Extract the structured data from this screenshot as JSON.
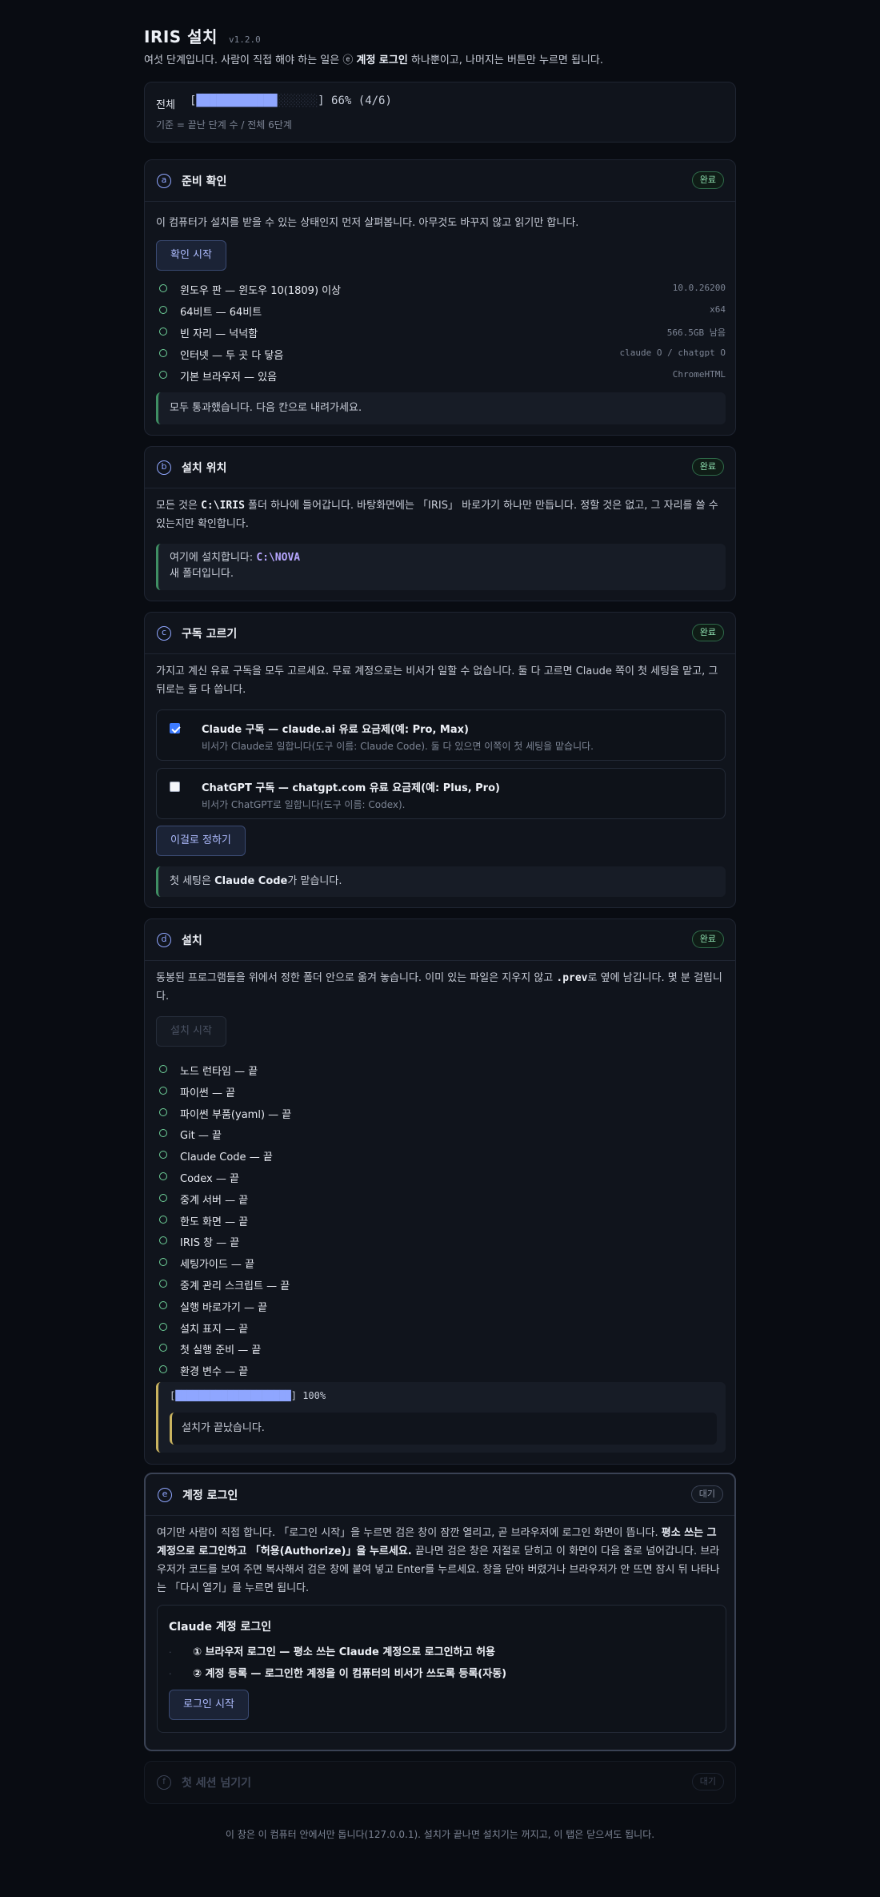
{
  "header": {
    "title": "IRIS 설치",
    "version": "v1.2.0",
    "intro_pre": "여섯 단계입니다. 사람이 직접 해야 하는 일은 ⓔ ",
    "intro_bold": "계정 로그인",
    "intro_post": " 하나뿐이고, 나머지는 버튼만 누르면 됩니다."
  },
  "overall": {
    "label": "전체",
    "bar_open": "[",
    "bar_filled": "████████████",
    "bar_empty": "░░░░░░",
    "bar_close": "]",
    "percent_text": "66% (4/6)",
    "progress": 0.66,
    "note": "기준 = 끝난 단계 수 / 전체 6단계"
  },
  "step_a": {
    "letter": "a",
    "title": "준비 확인",
    "badge": "완료",
    "desc": "이 컴퓨터가 설치를 받을 수 있는 상태인지 먼저 살펴봅니다. 아무것도 바꾸지 않고 읽기만 합니다.",
    "button": "확인 시작",
    "checks": [
      {
        "label": "윈도우 판 — 윈도우 10(1809) 이상",
        "value": "10.0.26200"
      },
      {
        "label": "64비트 — 64비트",
        "value": "x64"
      },
      {
        "label": "빈 자리 — 넉넉함",
        "value": "566.5GB 남음"
      },
      {
        "label": "인터넷 — 두 곳 다 닿음",
        "value": "claude O / chatgpt O"
      },
      {
        "label": "기본 브라우저 — 있음",
        "value": "ChromeHTML"
      }
    ],
    "note": "모두 통과했습니다. 다음 칸으로 내려가세요."
  },
  "step_b": {
    "letter": "b",
    "title": "설치 위치",
    "badge": "완료",
    "desc_pre": "모든 것은 ",
    "desc_code": "C:\\IRIS",
    "desc_post": " 폴더 하나에 들어갑니다. 바탕화면에는 「IRIS」 바로가기 하나만 만듭니다. 정할 것은 없고, 그 자리를 쓸 수 있는지만 확인합니다.",
    "note_pre": "여기에 설치합니다: ",
    "note_code": "C:\\NOVA",
    "note_line2": "새 폴더입니다."
  },
  "step_c": {
    "letter": "c",
    "title": "구독 고르기",
    "badge": "완료",
    "desc": "가지고 계신 유료 구독을 모두 고르세요. 무료 계정으로는 비서가 일할 수 없습니다. 둘 다 고르면 Claude 쪽이 첫 세팅을 맡고, 그 뒤로는 둘 다 씁니다.",
    "options": [
      {
        "title": "Claude 구독 — claude.ai 유료 요금제(예: Pro, Max)",
        "sub": "비서가 Claude로 일합니다(도구 이름: Claude Code). 둘 다 있으면 이쪽이 첫 세팅을 맡습니다.",
        "checked": true
      },
      {
        "title": "ChatGPT 구독 — chatgpt.com 유료 요금제(예: Plus, Pro)",
        "sub": "비서가 ChatGPT로 일합니다(도구 이름: Codex).",
        "checked": false
      }
    ],
    "button": "이걸로 정하기",
    "note_pre": "첫 세팅은 ",
    "note_bold": "Claude Code",
    "note_post": "가 맡습니다."
  },
  "step_d": {
    "letter": "d",
    "title": "설치",
    "badge": "완료",
    "desc_pre": "동봉된 프로그램들을 위에서 정한 폴더 안으로 옮겨 놓습니다. 이미 있는 파일은 지우지 않고 ",
    "desc_code": ".prev",
    "desc_post": "로 옆에 남깁니다. 몇 분 걸립니다.",
    "button": "설치 시작",
    "items": [
      "노드 런타임 — 끝",
      "파이썬 — 끝",
      "파이썬 부품(yaml) — 끝",
      "Git — 끝",
      "Claude Code — 끝",
      "Codex — 끝",
      "중계 서버 — 끝",
      "한도 화면 — 끝",
      "IRIS 창 — 끝",
      "세팅가이드 — 끝",
      "중계 관리 스크립트 — 끝",
      "실행 바로가기 — 끝",
      "설치 표지 — 끝",
      "첫 실행 준비 — 끝",
      "환경 변수 — 끝"
    ],
    "bar_open": "[",
    "bar_filled": "████████████████████",
    "bar_close": "]",
    "percent_text": "100%",
    "progress": 1.0,
    "done_note": "설치가 끝났습니다."
  },
  "step_e": {
    "letter": "e",
    "title": "계정 로그인",
    "badge": "대기",
    "desc_1": "여기만 사람이 직접 합니다. 「로그인 시작」을 누르면 검은 창이 잠깐 열리고, 곧 브라우저에 로그인 화면이 뜹니다. ",
    "desc_bold_1": "평소 쓰는 그 계정으로 로그인하고 「허용(Authorize)」을 누르세요.",
    "desc_2": " 끝나면 검은 창은 저절로 닫히고 이 화면이 다음 줄로 넘어갑니다. 브라우저가 코드를 보여 주면 복사해서 검은 창에 붙여 넣고 Enter를 누르세요. 창을 닫아 버렸거나 브라우저가 안 뜨면 잠시 뒤 나타나는 「다시 열기」를 누르면 됩니다.",
    "login_title": "Claude 계정 로그인",
    "login_steps": [
      {
        "bullet": "·",
        "text": "① 브라우저 로그인 — 평소 쓰는 Claude 계정으로 로그인하고 허용"
      },
      {
        "bullet": "·",
        "text": "② 계정 등록 — 로그인한 계정을 이 컴퓨터의 비서가 쓰도록 등록(자동)"
      }
    ],
    "button": "로그인 시작"
  },
  "step_f": {
    "letter": "f",
    "title": "첫 세션 넘기기",
    "badge": "대기"
  },
  "footer": "이 창은 이 컴퓨터 안에서만 돕니다(127.0.0.1). 설치가 끝나면 설치기는 꺼지고, 이 탭은 닫으셔도 됩니다."
}
